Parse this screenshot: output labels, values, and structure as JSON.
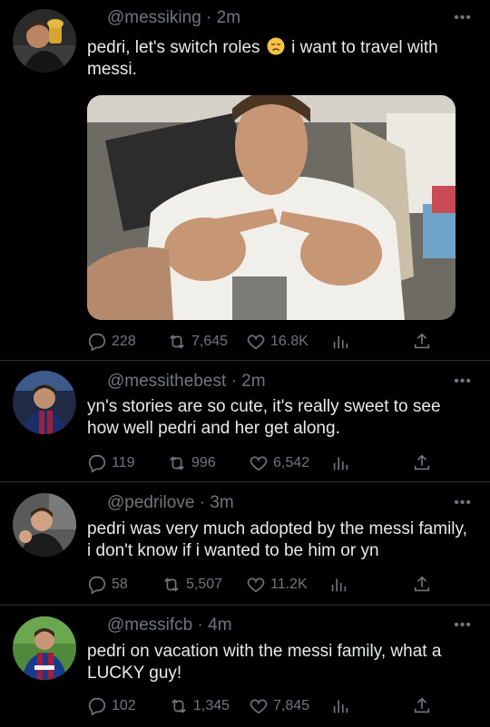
{
  "tweets": [
    {
      "handle": "@messiking",
      "time": "2m",
      "text_before": "pedri, let's switch roles",
      "emoji": "disappointed-face",
      "text_after": " i want to travel with messi.",
      "replies": "228",
      "retweets": "7,645",
      "likes": "16.8K"
    },
    {
      "handle": "@messithebest",
      "time": "2m",
      "text": "yn's stories are so cute, it's really sweet to see how well pedri and her get along.",
      "replies": "119",
      "retweets": "996",
      "likes": "6,542"
    },
    {
      "handle": "@pedrilove",
      "time": "3m",
      "text": "pedri was very much adopted by the messi family, i don't know if i wanted to be him or yn",
      "replies": "58",
      "retweets": "5,507",
      "likes": "11.2K"
    },
    {
      "handle": "@messifcb",
      "time": "4m",
      "text": "pedri on vacation with the messi family, what a LUCKY guy!",
      "replies": "102",
      "retweets": "1,345",
      "likes": "7,845"
    }
  ],
  "separator": " · ",
  "more_label": "•••",
  "colors": {
    "background": "#000000",
    "text": "#e7e9ea",
    "muted": "#71767b",
    "divider": "#2f3336"
  }
}
